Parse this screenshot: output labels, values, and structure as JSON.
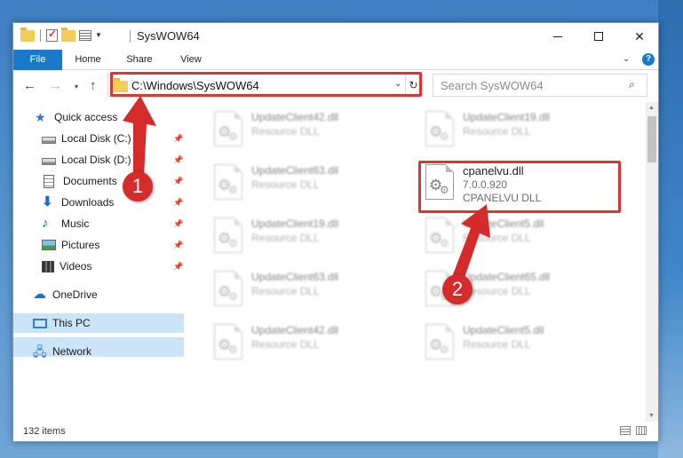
{
  "window": {
    "title": "SysWOW64",
    "controls": {
      "minimize": "–",
      "maximize": "□",
      "close": "✕"
    }
  },
  "ribbon": {
    "tabs": [
      {
        "label": "File",
        "active": true
      },
      {
        "label": "Home"
      },
      {
        "label": "Share"
      },
      {
        "label": "View"
      }
    ],
    "help": "?",
    "chevron": "⌄"
  },
  "navigation": {
    "back": "←",
    "forward": "→",
    "recent": "▾",
    "up": "↑",
    "address": "C:\\Windows\\SysWOW64",
    "address_dropdown": "⌄",
    "refresh": "↻",
    "search_placeholder": "Search SysWOW64",
    "search_icon": "⌕"
  },
  "sidebar": {
    "items": [
      {
        "label": "Quick access",
        "icon": "star-icon",
        "pinned": false
      },
      {
        "label": "Local Disk (C:)",
        "icon": "drive-icon",
        "pinned": true
      },
      {
        "label": "Local Disk (D:)",
        "icon": "drive-icon",
        "pinned": true
      },
      {
        "label": "Documents",
        "icon": "documents-icon",
        "pinned": true
      },
      {
        "label": "Downloads",
        "icon": "downloads-icon",
        "pinned": true
      },
      {
        "label": "Music",
        "icon": "music-icon",
        "pinned": true
      },
      {
        "label": "Pictures",
        "icon": "pictures-icon",
        "pinned": true
      },
      {
        "label": "Videos",
        "icon": "videos-icon",
        "pinned": true
      },
      {
        "label": "OneDrive",
        "icon": "onedrive-icon",
        "pinned": false
      },
      {
        "label": "This PC",
        "icon": "this-pc-icon",
        "pinned": false,
        "selected": true
      },
      {
        "label": "Network",
        "icon": "network-icon",
        "pinned": false
      }
    ],
    "pin_glyph": "📌"
  },
  "files": [
    {
      "name": "UpdateClient42.dll",
      "line2": "Resource DLL",
      "blurred": true
    },
    {
      "name": "UpdateClient19.dll",
      "line2": "Resource DLL",
      "blurred": true
    },
    {
      "name": "UpdateClient63.dll",
      "line2": "Resource DLL",
      "blurred": true
    },
    {
      "name": "cpanelvu.dll",
      "line2": "7.0.0.920",
      "line3": "CPANELVU DLL",
      "blurred": false,
      "highlighted": true
    },
    {
      "name": "UpdateClient19.dll",
      "line2": "Resource DLL",
      "blurred": true
    },
    {
      "name": "UpdateClient5.dll",
      "line2": "Resource DLL",
      "blurred": true
    },
    {
      "name": "UpdateClient63.dll",
      "line2": "Resource DLL",
      "blurred": true
    },
    {
      "name": "UpdateClient65.dll",
      "line2": "Resource DLL",
      "blurred": true
    },
    {
      "name": "UpdateClient42.dll",
      "line2": "Resource DLL",
      "blurred": true
    },
    {
      "name": "UpdateClient5.dll",
      "line2": "Resource DLL",
      "blurred": true
    }
  ],
  "status": {
    "item_count": "132 items"
  },
  "annotations": {
    "marker1": "1",
    "marker2": "2",
    "color": "#d52b2b"
  },
  "colors": {
    "accent": "#1979ca",
    "selected": "#cce4f7",
    "highlight": "#dd3333"
  }
}
